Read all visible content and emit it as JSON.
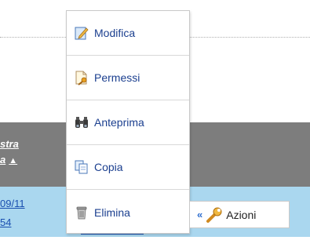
{
  "header": {
    "col_label_line1": "stra",
    "col_label_line2": "a",
    "sort_indicator": "▲"
  },
  "row": {
    "date_text": "09/11",
    "extra_text": "54"
  },
  "menu": {
    "items": [
      {
        "label": "Modifica",
        "icon": "edit-icon"
      },
      {
        "label": "Permessi",
        "icon": "key-document-icon"
      },
      {
        "label": "Anteprima",
        "icon": "binoculars-icon"
      },
      {
        "label": "Copia",
        "icon": "copy-icon"
      },
      {
        "label": "Elimina",
        "icon": "trash-icon"
      }
    ]
  },
  "actions": {
    "label": "Azioni",
    "chevron": "«",
    "icon": "wrench-icon"
  },
  "colors": {
    "header_band": "#7d7d7d",
    "row_band": "#aad7ef",
    "menu_text": "#1b3f8f",
    "link": "#1a4fb0"
  }
}
